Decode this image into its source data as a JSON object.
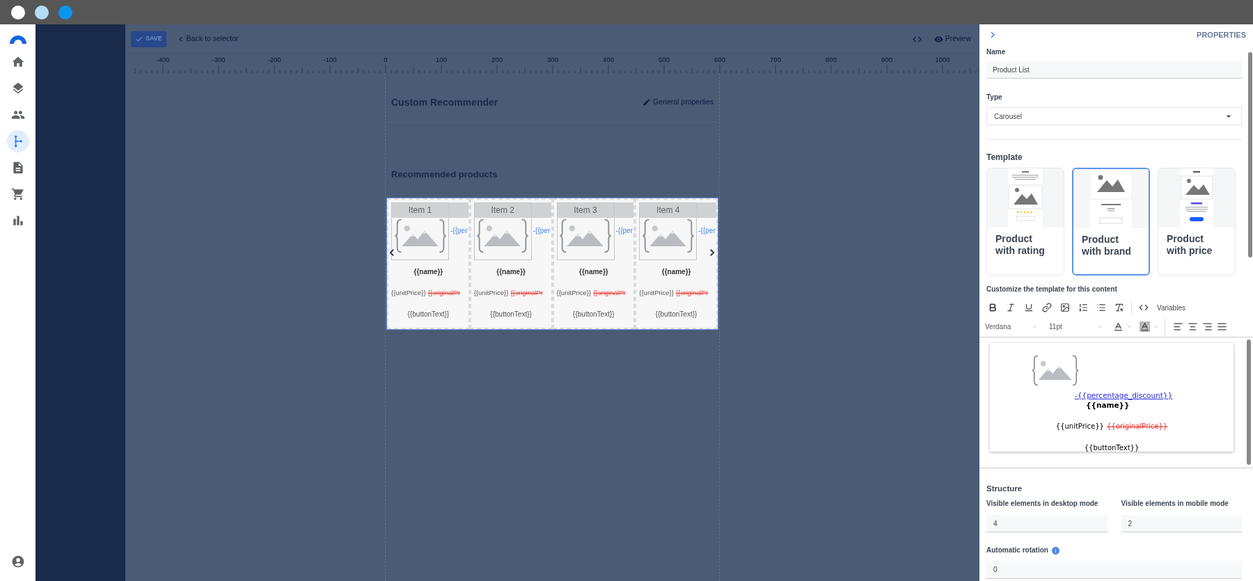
{
  "window_controls": [
    {
      "color": "#ffffff"
    },
    {
      "color": "#b3dcf7"
    },
    {
      "color": "#0a96ec"
    }
  ],
  "nav": {
    "items": [
      {
        "kind": "home",
        "selected": false
      },
      {
        "kind": "layers",
        "selected": false
      },
      {
        "kind": "people",
        "selected": false
      },
      {
        "kind": "flow",
        "selected": true
      },
      {
        "kind": "document",
        "selected": false
      },
      {
        "kind": "cart",
        "selected": false
      },
      {
        "kind": "chart",
        "selected": false
      }
    ],
    "bottom": {
      "kind": "account",
      "selected": false
    }
  },
  "toolbar": {
    "save": "SAVE",
    "back": "Back to selector",
    "preview": "Preview"
  },
  "ruler": {
    "labels": [
      "-400",
      "-300",
      "-200",
      "-100",
      "0",
      "100",
      "200",
      "300",
      "400",
      "500",
      "600",
      "700",
      "800",
      "900",
      "1000"
    ]
  },
  "canvas": {
    "title": "Custom Recommender",
    "general_properties": "General properties",
    "section_title": "Recommended products",
    "items": [
      {
        "label": "Item 1",
        "discount": "-{{per",
        "name": "{{name}}",
        "unit_price": "{{unitPrice}}",
        "original_price": "{{originalPr",
        "button_text": "{{buttonText}}"
      },
      {
        "label": "Item 2",
        "discount": "-{{per",
        "name": "{{name}}",
        "unit_price": "{{unitPrice}}",
        "original_price": "{{originalPr",
        "button_text": "{{buttonText}}"
      },
      {
        "label": "Item 3",
        "discount": "-{{per",
        "name": "{{name}}",
        "unit_price": "{{unitPrice}}",
        "original_price": "{{originalPr",
        "button_text": "{{buttonText}}"
      },
      {
        "label": "Item 4",
        "discount": "-{{per",
        "name": "{{name}}",
        "unit_price": "{{unitPrice}}",
        "original_price": "{{originalPr",
        "button_text": "{{buttonText}}"
      }
    ]
  },
  "properties": {
    "title": "PROPERTIES",
    "name_label": "Name",
    "name_value": "Product List",
    "type_label": "Type",
    "type_value": "Carousel",
    "template_label": "Template",
    "templates": [
      {
        "kind": "rating",
        "label": "Product with rating",
        "selected": false
      },
      {
        "kind": "brand",
        "label": "Product with brand",
        "selected": true
      },
      {
        "kind": "price",
        "label": "Product with price",
        "selected": false
      }
    ],
    "customize_label": "Customize the template for this content",
    "editor": {
      "variables": "Variables",
      "font": "Verdana",
      "size": "11pt",
      "preview": {
        "discount": "-{{percentage_discount}}",
        "name": "{{name}}",
        "unit_price": "{{unitPrice}}",
        "original_price": "{{originalPrice}}",
        "button_text": "{{buttonText}}"
      }
    },
    "structure": {
      "title": "Structure",
      "desktop_label": "Visible elements in desktop mode",
      "desktop_value": "4",
      "mobile_label": "Visible elements in mobile mode",
      "mobile_value": "2",
      "rotation_label": "Automatic rotation",
      "rotation_value": "0"
    }
  }
}
